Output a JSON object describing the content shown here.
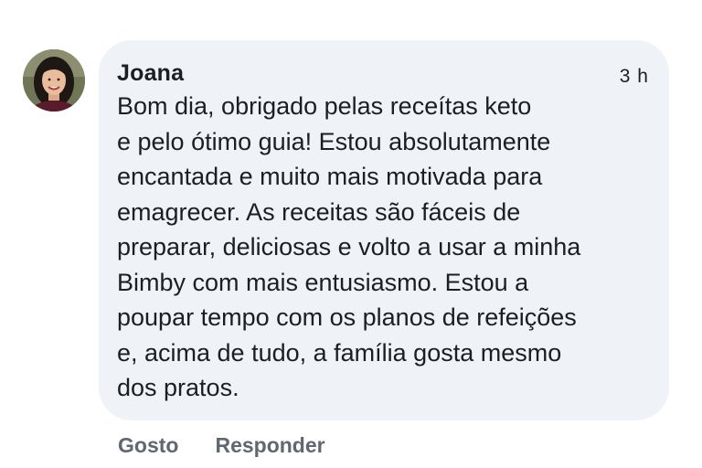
{
  "comment": {
    "author": "Joana",
    "timestamp": "3 h",
    "text_lines": [
      "Bom dia, obrigado pelas receítas keto",
      "e pelo ótimo guia! Estou absolutamente",
      "encantada e muito mais motivada para",
      "emagrecer. As receitas são fáceis de",
      "preparar, deliciosas e volto a usar a minha",
      "Bimby com mais entusiasmo. Estou a",
      "poupar tempo com os planos de refeições",
      "e, acima de tudo, a família gosta mesmo",
      "dos pratos."
    ]
  },
  "actions": {
    "like_label": "Gosto",
    "reply_label": "Responder"
  },
  "colors": {
    "bubble_background": "#eff2f7",
    "text": "#1c1e21",
    "action_text": "#606770"
  },
  "icons": {
    "avatar": "user-avatar-photo"
  }
}
